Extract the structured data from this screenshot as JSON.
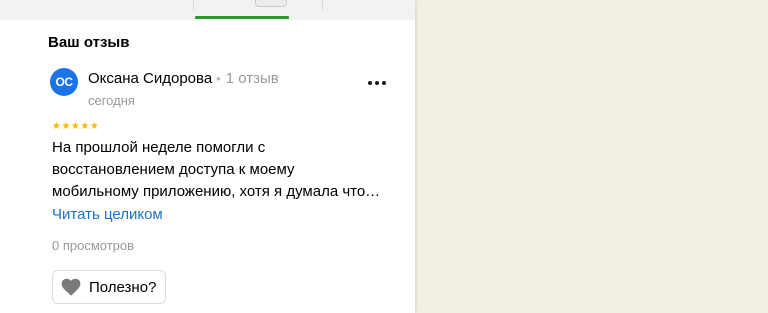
{
  "section": {
    "title": "Ваш отзыв"
  },
  "review": {
    "avatar_initials": "ОС",
    "author": "Оксана Сидорова",
    "separator": "•",
    "author_reviews": "1 отзыв",
    "date": "сегодня",
    "rating": 5,
    "stars": "★★★★★",
    "text_lines": [
      "На прошлой неделе помогли с",
      "восстановлением доступа к моему",
      "мобильному приложению, хотя я думала что…"
    ],
    "read_more": "Читать целиком",
    "views": "0 просмотров",
    "helpful_label": "Полезно?"
  },
  "icons": {
    "more": "more-dots-icon",
    "helpful": "heart-icon"
  },
  "colors": {
    "accent_green": "#2c9a2a",
    "avatar_blue": "#1a73e8",
    "link_blue": "#1a73c9",
    "star_yellow": "#fcb900",
    "map_background": "#f3efe3"
  }
}
